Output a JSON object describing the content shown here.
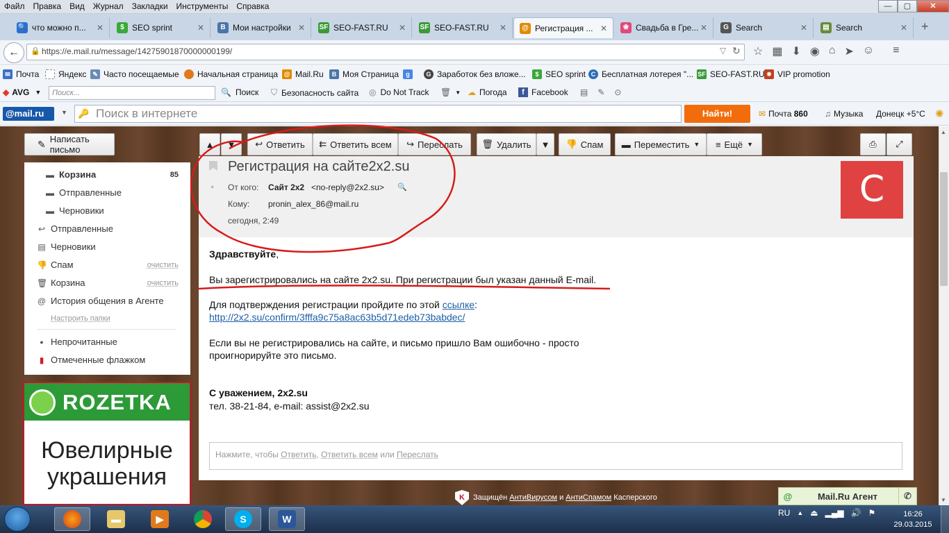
{
  "menubar": {
    "items": [
      "Файл",
      "Правка",
      "Вид",
      "Журнал",
      "Закладки",
      "Инструменты",
      "Справка"
    ]
  },
  "tabs": [
    {
      "label": "что можно п...",
      "icon": "search-icon",
      "color": "#2a6fd6"
    },
    {
      "label": "SEO sprint",
      "icon": "seo-sprint-icon",
      "color": "#3aa83a"
    },
    {
      "label": "Мои настройки",
      "icon": "vk-icon",
      "color": "#4a76a8"
    },
    {
      "label": "SEO-FAST.RU",
      "icon": "seofast-icon",
      "color": "#3a9a3a"
    },
    {
      "label": "SEO-FAST.RU",
      "icon": "seofast-icon",
      "color": "#3a9a3a"
    },
    {
      "label": "Регистрация ...",
      "icon": "mailru-icon",
      "color": "#e08a00",
      "active": true
    },
    {
      "label": "Свадьба в Гре...",
      "icon": "wedding-icon",
      "color": "#e04a7a"
    },
    {
      "label": "Search",
      "icon": "google-icon",
      "color": "#555555"
    },
    {
      "label": "Search",
      "icon": "search-page-icon",
      "color": "#6a8a3a"
    }
  ],
  "url": "https://e.mail.ru/message/14275901870000000199/",
  "bookmarks": [
    {
      "label": "Почта",
      "color": "#3a6fc6"
    },
    {
      "label": "Яндекс",
      "color": "#ffffff"
    },
    {
      "label": "Часто посещаемые",
      "color": "#6a8ab6"
    },
    {
      "label": "Начальная страница",
      "color": "#e07a1a"
    },
    {
      "label": "Mail.Ru",
      "color": "#e08a00"
    },
    {
      "label": "Моя Страница",
      "color": "#4a76a8"
    },
    {
      "label": "",
      "color": "#4a86e8"
    },
    {
      "label": "Заработок без вложе...",
      "color": "#444444"
    },
    {
      "label": "SEO sprint",
      "color": "#3aa83a"
    },
    {
      "label": "Бесплатная лотерея \"...",
      "color": "#2a6fb6"
    },
    {
      "label": "SEO-FAST.RU",
      "color": "#3a9a3a"
    },
    {
      "label": "VIP promotion",
      "color": "#c04020"
    }
  ],
  "avgbar": {
    "brand": "AVG",
    "search_placeholder": "Поиск...",
    "search_label": "Поиск",
    "security_label": "Безопасность сайта",
    "dnt_label": "Do Not Track",
    "weather_label": "Погода",
    "facebook_label": "Facebook"
  },
  "mailbar": {
    "logo": "@mail.ru",
    "search_placeholder": "Поиск в интернете",
    "find_label": "Найти!",
    "mail_label": "Почта",
    "mail_count": "860",
    "music_label": "Музыка",
    "weather_label": "Донецк +5°C"
  },
  "compose_label": "Написать письмо",
  "toolbar": {
    "reply": "Ответить",
    "reply_all": "Ответить всем",
    "forward": "Переслать",
    "delete": "Удалить",
    "spam": "Спам",
    "move": "Переместить",
    "more": "Ещё"
  },
  "sidebar": {
    "folders": [
      {
        "label": "Корзина",
        "count": "85",
        "bold": true,
        "indent": true,
        "icon": "folder-icon"
      },
      {
        "label": "Отправленные",
        "indent": true,
        "icon": "folder-icon"
      },
      {
        "label": "Черновики",
        "indent": true,
        "icon": "folder-icon"
      },
      {
        "label": "Отправленные",
        "icon": "reply-arrow-icon"
      },
      {
        "label": "Черновики",
        "icon": "draft-icon"
      },
      {
        "label": "Спам",
        "clear": "очистить",
        "icon": "thumbs-down-icon"
      },
      {
        "label": "Корзина",
        "clear": "очистить",
        "icon": "trash-icon"
      },
      {
        "label": "История общения в Агенте",
        "icon": "at-icon"
      }
    ],
    "settings_link": "Настроить папки",
    "unread": "Непрочитанные",
    "flagged": "Отмеченные флажком"
  },
  "ad": {
    "brand": "ROZETKA",
    "text": "Ювелирные украшения",
    "brand_color": "#2d9a38"
  },
  "message": {
    "subject": "Регистрация на сайте2x2.su",
    "from_label": "От кого:",
    "from_name": "Сайт 2x2",
    "from_email": "<no-reply@2x2.su>",
    "to_label": "Кому:",
    "to_email": "pronin_alex_86@mail.ru",
    "date": "сегодня, 2:49",
    "avatar_letter": "С",
    "avatar_color": "#e04242",
    "greeting": "Здравствуйте",
    "greeting_punct": ",",
    "line1": "Вы зарегистрировались на сайте 2x2.su. При регистрации был указан данный E-mail.",
    "line2": "Для подтверждения регистрации пройдите по этой",
    "line2_link": "ссылке",
    "line2_colon": ":",
    "confirm_url": "http://2x2.su/confirm/3fffa9c75a8ac63b5d71edeb73babdec/",
    "line3a": "Если вы не регистрировались на сайте, и письмо пришло Вам ошибочно - просто",
    "line3b": "проигнорируйте это письмо.",
    "sign1": "С уважением, 2x2.su",
    "sign2": "тел. 38-21-84, e-mail: assist@2x2.su"
  },
  "replybox": {
    "prefix": "Нажмите, чтобы",
    "reply": "Ответить",
    "sep1": ",",
    "reply_all": "Ответить всем",
    "sep2": "или",
    "forward": "Переслать"
  },
  "kaspersky": {
    "t1": "Защищён",
    "link1": "АнтиВирусом",
    "t2": "и",
    "link2": "АнтиСпамом",
    "t3": "Касперского"
  },
  "agent_label": "Mail.Ru Агент",
  "taskbar": {
    "lang": "RU",
    "time": "16:26",
    "date": "29.03.2015"
  }
}
